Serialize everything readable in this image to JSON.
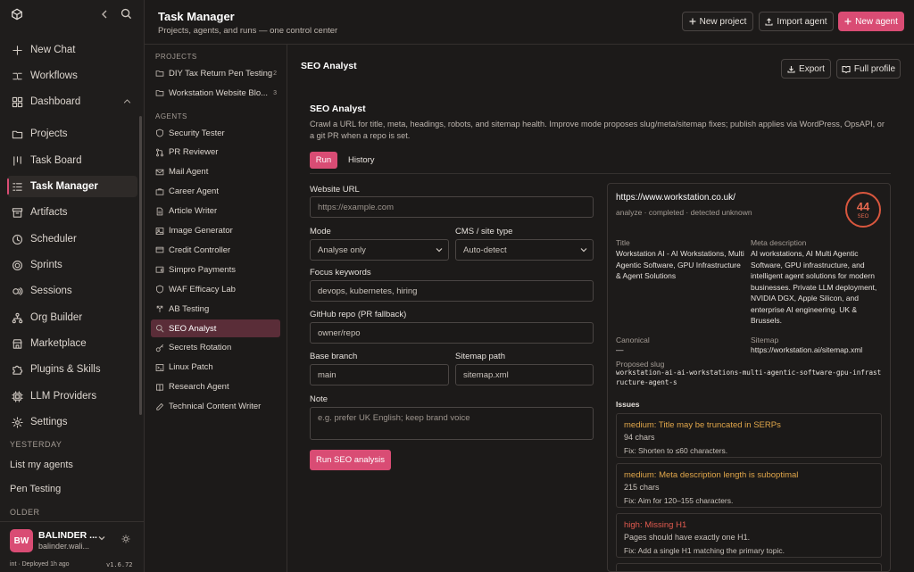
{
  "sidebar": {
    "nav": [
      {
        "label": "New Chat",
        "icon": "plus-icon"
      },
      {
        "label": "Workflows",
        "icon": "workflow-icon"
      },
      {
        "label": "Dashboard",
        "icon": "dashboard-icon"
      },
      {
        "label": "Projects",
        "icon": "folder-icon"
      },
      {
        "label": "Task Board",
        "icon": "board-icon"
      },
      {
        "label": "Task Manager",
        "icon": "list-icon"
      },
      {
        "label": "Artifacts",
        "icon": "archive-icon"
      },
      {
        "label": "Scheduler",
        "icon": "clock-icon"
      },
      {
        "label": "Sprints",
        "icon": "target-icon"
      },
      {
        "label": "Sessions",
        "icon": "sessions-icon"
      },
      {
        "label": "Org Builder",
        "icon": "org-icon"
      },
      {
        "label": "Marketplace",
        "icon": "store-icon"
      },
      {
        "label": "Plugins & Skills",
        "icon": "puzzle-icon"
      },
      {
        "label": "LLM Providers",
        "icon": "cpu-icon"
      },
      {
        "label": "Settings",
        "icon": "gear-icon"
      }
    ],
    "yesterday_label": "YESTERDAY",
    "yesterday_items": [
      "List my agents",
      "Pen Testing"
    ],
    "older_label": "OLDER",
    "user": {
      "initials": "BW",
      "name": "BALINDER ...",
      "email": "balinder.wali...",
      "footer_left": "int · Deployed 1h ago",
      "version": "v1.6.72"
    }
  },
  "header": {
    "title": "Task Manager",
    "subtitle": "Projects, agents, and runs — one control center",
    "new_project": "New project",
    "import_agent": "Import agent",
    "new_agent": "New agent"
  },
  "midlist": {
    "projects_label": "PROJECTS",
    "projects": [
      {
        "label": "DIY Tax Return Pen Testing",
        "count": "2"
      },
      {
        "label": "Workstation Website Blo...",
        "count": "3"
      }
    ],
    "agents_label": "AGENTS",
    "agents": [
      {
        "label": "Security Tester",
        "icon": "shield-icon"
      },
      {
        "label": "PR Reviewer",
        "icon": "git-pull-request-icon"
      },
      {
        "label": "Mail Agent",
        "icon": "mail-icon"
      },
      {
        "label": "Career Agent",
        "icon": "briefcase-icon"
      },
      {
        "label": "Article Writer",
        "icon": "document-icon"
      },
      {
        "label": "Image Generator",
        "icon": "image-icon"
      },
      {
        "label": "Credit Controller",
        "icon": "credit-card-icon"
      },
      {
        "label": "Simpro Payments",
        "icon": "wallet-icon"
      },
      {
        "label": "WAF Efficacy Lab",
        "icon": "shield-icon"
      },
      {
        "label": "AB Testing",
        "icon": "split-icon"
      },
      {
        "label": "SEO Analyst",
        "icon": "search-icon"
      },
      {
        "label": "Secrets Rotation",
        "icon": "key-icon"
      },
      {
        "label": "Linux Patch",
        "icon": "terminal-icon"
      },
      {
        "label": "Research Agent",
        "icon": "book-icon"
      },
      {
        "label": "Technical Content Writer",
        "icon": "pen-icon"
      }
    ]
  },
  "main": {
    "heading": "SEO Analyst",
    "export": "Export",
    "full_profile": "Full profile",
    "agent_title": "SEO Analyst",
    "agent_desc": "Crawl a URL for title, meta, headings, robots, and sitemap health. Improve mode proposes slug/meta/sitemap fixes; publish applies via WordPress, OpsAPI, or a git PR when a repo is set.",
    "tab_run": "Run",
    "tab_history": "History",
    "form": {
      "url_label": "Website URL",
      "url_placeholder": "https://example.com",
      "mode_label": "Mode",
      "mode_value": "Analyse only",
      "cms_label": "CMS / site type",
      "cms_value": "Auto-detect",
      "keywords_label": "Focus keywords",
      "keywords_value": "devops, kubernetes, hiring",
      "repo_label": "GitHub repo (PR fallback)",
      "repo_value": "owner/repo",
      "branch_label": "Base branch",
      "branch_value": "main",
      "sitemap_label": "Sitemap path",
      "sitemap_value": "sitemap.xml",
      "note_label": "Note",
      "note_placeholder": "e.g. prefer UK English; keep brand voice",
      "run_button": "Run SEO analysis"
    },
    "result": {
      "url": "https://www.workstation.co.uk/",
      "status": "analyze · completed · detected unknown",
      "score": "44",
      "score_label": "SEO",
      "title_label": "Title",
      "title_value": "Workstation AI - AI Workstations, Multi Agentic Software, GPU Infrastructure & Agent Solutions",
      "meta_label": "Meta description",
      "meta_value": "AI workstations, AI Multi Agentic Software, GPU infrastructure, and intelligent agent solutions for modern businesses. Private LLM deployment, NVIDIA DGX, Apple Silicon, and enterprise AI engineering. UK & Brussels.",
      "canonical_label": "Canonical",
      "canonical_value": "—",
      "sitemap_label": "Sitemap",
      "sitemap_value": "https://workstation.ai/sitemap.xml",
      "slug_label": "Proposed slug",
      "slug_value": "workstation-ai-ai-workstations-multi-agentic-software-gpu-infrastructure-agent-s",
      "issues_label": "Issues",
      "issues": [
        {
          "title": "medium: Title may be truncated in SERPs",
          "count": "94 chars",
          "fix": "Fix: Shorten to ≤60 characters.",
          "color": "#e0a64a"
        },
        {
          "title": "medium: Meta description length is suboptimal",
          "count": "215 chars",
          "fix": "Fix: Aim for 120–155 characters.",
          "color": "#e0a64a"
        },
        {
          "title": "high: Missing H1",
          "count": "Pages should have exactly one H1.",
          "fix": "Fix: Add a single H1 matching the primary topic.",
          "color": "#e05a4f"
        }
      ]
    }
  },
  "colors": {
    "accent": "#d94c74",
    "medium": "#e0a64a",
    "high": "#e05a4f"
  }
}
